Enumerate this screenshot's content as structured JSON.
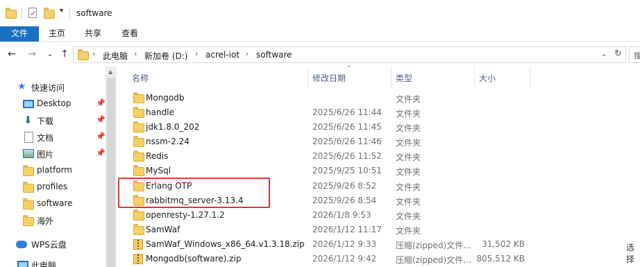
{
  "window": {
    "title": "software"
  },
  "ribbon": {
    "tabs": [
      {
        "label": "文件",
        "active": true
      },
      {
        "label": "主页",
        "active": false
      },
      {
        "label": "共享",
        "active": false
      },
      {
        "label": "查看",
        "active": false
      }
    ]
  },
  "nav": {
    "back_icon": "←",
    "forward_icon": "→",
    "recent_icon": "⌄",
    "up_icon": "↑",
    "breadcrumb": [
      "此电脑",
      "新加卷 (D:)",
      "acrel-iot",
      "software"
    ],
    "search_stub": "搜"
  },
  "sidebar": {
    "quick_access": "快速访问",
    "items": [
      {
        "label": "Desktop",
        "icon": "desktop-icon",
        "pinned": true
      },
      {
        "label": "下载",
        "icon": "download-icon",
        "pinned": true
      },
      {
        "label": "文档",
        "icon": "document-icon",
        "pinned": true
      },
      {
        "label": "图片",
        "icon": "pictures-icon",
        "pinned": true
      },
      {
        "label": "platform",
        "icon": "folder-icon",
        "pinned": false
      },
      {
        "label": "profiles",
        "icon": "folder-icon",
        "pinned": false
      },
      {
        "label": "software",
        "icon": "folder-icon",
        "pinned": false
      },
      {
        "label": "海外",
        "icon": "folder-icon",
        "pinned": false
      }
    ],
    "wps": "WPS云盘",
    "this_pc": "此电脑"
  },
  "columns": {
    "name": "名称",
    "date": "修改日期",
    "type": "类型",
    "size": "大小"
  },
  "files": [
    {
      "name": "Mongodb",
      "date": "",
      "type": "文件夹",
      "size": "",
      "kind": "folder"
    },
    {
      "name": "handle",
      "date": "2025/6/26 11:44",
      "type": "文件夹",
      "size": "",
      "kind": "folder"
    },
    {
      "name": "jdk1.8.0_202",
      "date": "2025/6/26 11:45",
      "type": "文件夹",
      "size": "",
      "kind": "folder"
    },
    {
      "name": "nssm-2.24",
      "date": "2025/6/26 11:46",
      "type": "文件夹",
      "size": "",
      "kind": "folder"
    },
    {
      "name": "Redis",
      "date": "2025/6/26 11:52",
      "type": "文件夹",
      "size": "",
      "kind": "folder"
    },
    {
      "name": "MySql",
      "date": "2025/9/25 10:51",
      "type": "文件夹",
      "size": "",
      "kind": "folder"
    },
    {
      "name": "Erlang OTP",
      "date": "2025/9/26 8:52",
      "type": "文件夹",
      "size": "",
      "kind": "folder"
    },
    {
      "name": "rabbitmq_server-3.13.4",
      "date": "2025/9/26 8:54",
      "type": "文件夹",
      "size": "",
      "kind": "folder"
    },
    {
      "name": "openresty-1.27.1.2",
      "date": "2026/1/8 9:53",
      "type": "文件夹",
      "size": "",
      "kind": "folder"
    },
    {
      "name": "SamWaf",
      "date": "2026/1/12 11:17",
      "type": "文件夹",
      "size": "",
      "kind": "folder"
    },
    {
      "name": "SamWaf_Windows_x86_64.v1.3.18.zip",
      "date": "2026/1/12 9:33",
      "type": "压缩(zipped)文件...",
      "size": "31,502 KB",
      "kind": "zip"
    },
    {
      "name": "Mongodb(software).zip",
      "date": "2026/1/12 9:42",
      "type": "压缩(zipped)文件...",
      "size": "805,512 KB",
      "kind": "zip"
    }
  ],
  "status_right": "选择"
}
